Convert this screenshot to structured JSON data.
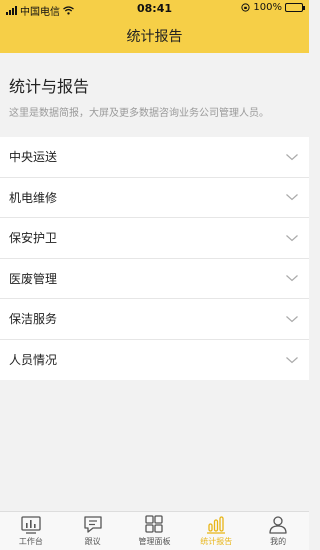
{
  "status_bar": {
    "carrier": "中国电信",
    "time": "08:41",
    "battery": "100%"
  },
  "nav": {
    "title": "统计报告"
  },
  "header": {
    "title": "统计与报告",
    "description": "这里是数据简报，大屏及更多数据咨询业务公司管理人员。"
  },
  "list": {
    "items": [
      {
        "label": "中央运送"
      },
      {
        "label": "机电维修"
      },
      {
        "label": "保安护卫"
      },
      {
        "label": "医废管理"
      },
      {
        "label": "保洁服务"
      },
      {
        "label": "人员情况"
      }
    ]
  },
  "tabs": [
    {
      "label": "工作台",
      "icon": "workbench-icon"
    },
    {
      "label": "跟议",
      "icon": "chat-icon"
    },
    {
      "label": "管理面板",
      "icon": "grid-icon"
    },
    {
      "label": "统计报告",
      "icon": "stats-icon",
      "active": true
    },
    {
      "label": "我的",
      "icon": "user-icon"
    }
  ],
  "colors": {
    "accent": "#f6cf47",
    "active_tab": "#e8b516"
  }
}
